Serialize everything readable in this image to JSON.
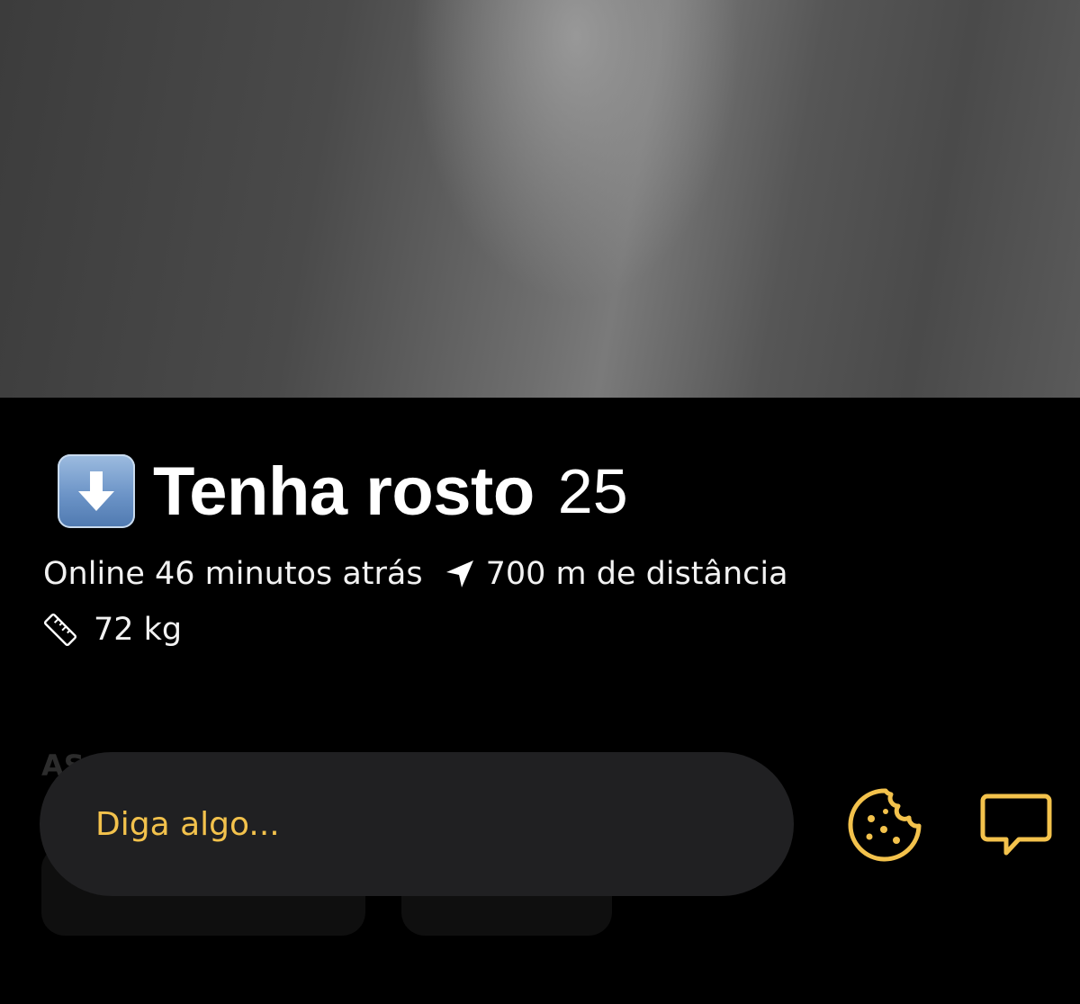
{
  "profile": {
    "emoji_icon": "down-arrow-emoji-icon",
    "name": "Tenha rosto",
    "age": "25",
    "online_status": "Online 46 minutos atrás",
    "distance": "700 m de distância",
    "weight": "72 kg"
  },
  "section_peek": "AS",
  "composer": {
    "placeholder": "Diga algo...",
    "cookie_button_icon": "cookie-icon",
    "chat_button_icon": "chat-bubble-icon",
    "accent_color": "#F3C24C"
  },
  "colors": {
    "background": "#000000",
    "input_background": "#202022"
  }
}
